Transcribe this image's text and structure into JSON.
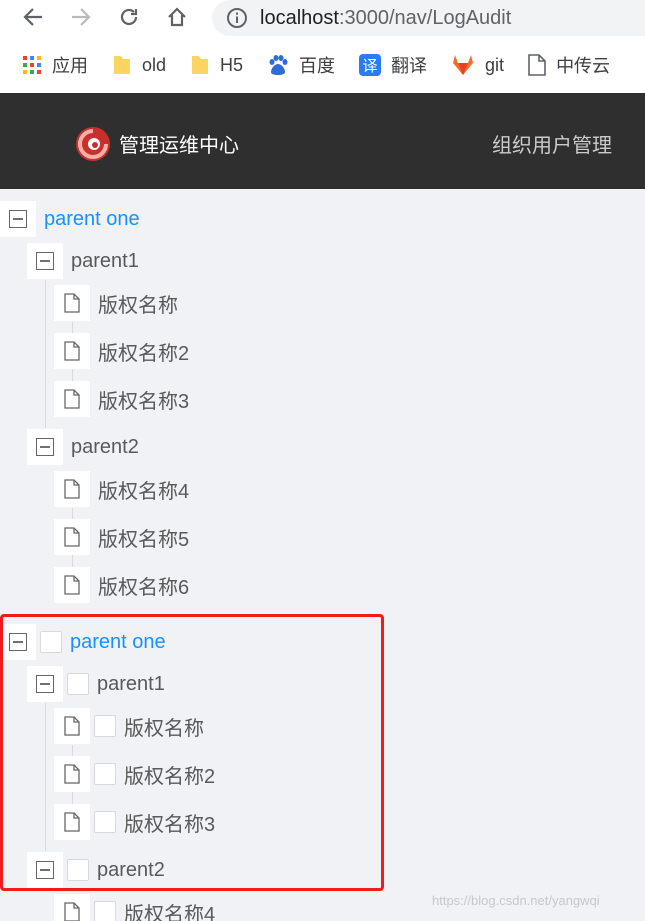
{
  "browser": {
    "address": {
      "host": "localhost",
      "path": ":3000/nav/LogAudit"
    },
    "bookmarks": [
      {
        "label": "应用",
        "icon": "apps-grid-icon"
      },
      {
        "label": "old",
        "icon": "folder-icon"
      },
      {
        "label": "H5",
        "icon": "folder-icon"
      },
      {
        "label": "百度",
        "icon": "baidu-paw-icon"
      },
      {
        "label": "翻译",
        "icon": "translate-icon"
      },
      {
        "label": "git",
        "icon": "gitlab-fox-icon"
      },
      {
        "label": "中传云",
        "icon": "page-icon"
      }
    ],
    "translate_glyph": "译"
  },
  "header": {
    "brand": "管理运维中心",
    "menu_item": "组织用户管理",
    "logo_icon": "red-swirl-logo-icon"
  },
  "tree_plain": {
    "root": "parent one",
    "parent1": "parent1",
    "parent1_children": [
      "版权名称",
      "版权名称2",
      "版权名称3"
    ],
    "parent2": "parent2",
    "parent2_children": [
      "版权名称4",
      "版权名称5",
      "版权名称6"
    ]
  },
  "tree_checkable": {
    "root": "parent one",
    "parent1": "parent1",
    "parent1_children": [
      "版权名称",
      "版权名称2",
      "版权名称3"
    ],
    "parent2": "parent2",
    "parent2_children": [
      "版权名称4"
    ]
  },
  "watermark": "https://blog.csdn.net/yangwqi",
  "colors": {
    "highlight": "#ee1c1c",
    "link": "#1890ff",
    "header_bg": "#2f2f2f"
  }
}
